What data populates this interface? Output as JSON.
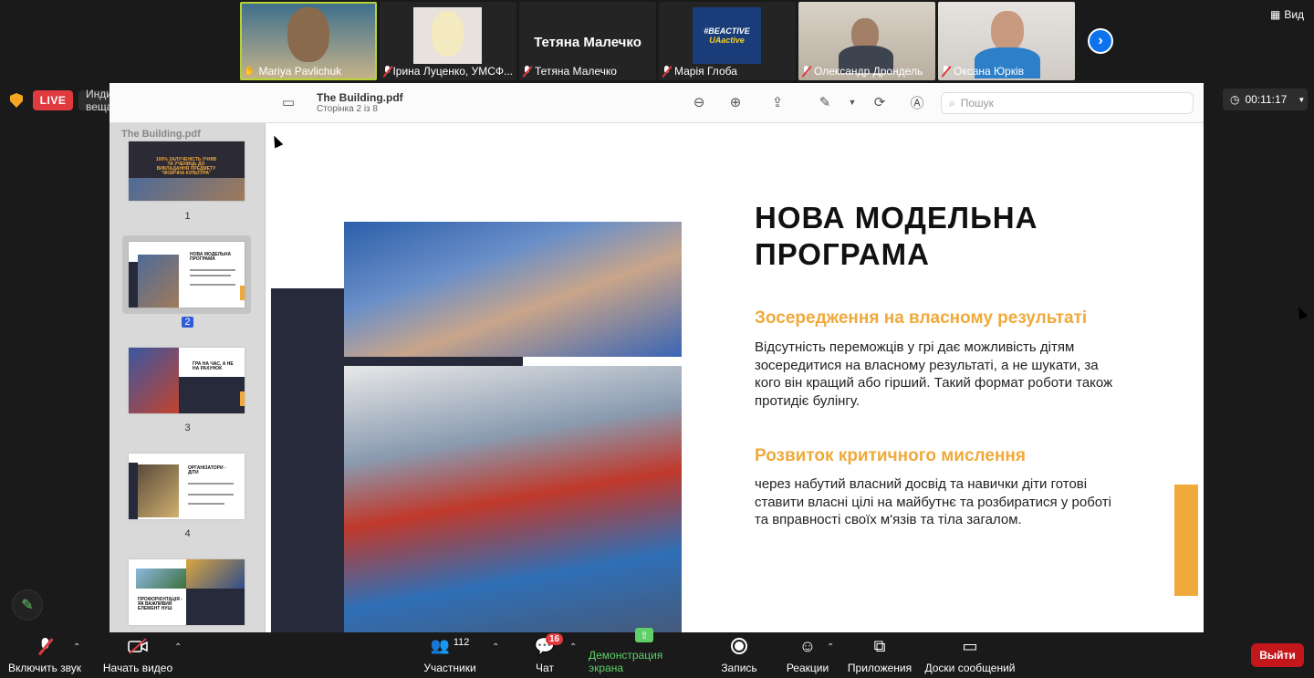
{
  "participants": [
    {
      "name": "Mariya Pavlichuk",
      "active": true
    },
    {
      "name": "Ірина Луценко, УМСФ..."
    },
    {
      "name": "Тетяна Малечко",
      "display": "Тетяна Малечко"
    },
    {
      "name": "Марія Глоба",
      "logo_line1": "#BEACTIVE",
      "logo_line2": "UAactive"
    },
    {
      "name": "Олександр Дрондель"
    },
    {
      "name": "Оксана Юрків"
    }
  ],
  "view_label": "Вид",
  "live_label": "LIVE",
  "stream_label": "Индивидуальная служба потокового вещания",
  "timer": "00:11:17",
  "pdf": {
    "title": "The Building.pdf",
    "page_info": "Сторінка 2 із 8",
    "search_placeholder": "Пошук",
    "sidebar_title": "The Building.pdf",
    "pages": [
      "1",
      "2",
      "3",
      "4"
    ],
    "thumb_texts": {
      "t1": "100% ЗАЛУЧЕНІСТЬ УЧНІВ ТА УЧЕНИЦЬ ДО ВИКЛАДАННЯ ПРЕДМЕТУ \"ФІЗИЧНА КУЛЬТУРА\"",
      "t2": "НОВА МОДЕЛЬНА ПРОГРАМА",
      "t3": "ГРА НА ЧАС, А НЕ НА РАХУНОК",
      "t4": "ОРГАНІЗАТОРИ - ДІТИ",
      "t5": "ПРОФОРІЄНТАЦІЯ - ЯК ВАЖЛИВИЙ ЕЛЕМЕНТ НУШ"
    }
  },
  "slide": {
    "title_line1": "НОВА МОДЕЛЬНА",
    "title_line2": "ПРОГРАМА",
    "h1": "Зосередження на власному результаті",
    "p1": "Відсутність переможців у грі дає можливість дітям зосередитися на власному результаті, а не шукати, за кого він кращий або гірший. Такий формат роботи також протидіє булінгу.",
    "h2": "Розвиток критичного мислення",
    "p2": "через набутий власний досвід та навички діти готові ставити власні цілі на майбутнє та розбиратися у роботі та вправності своїх м'язів та тіла загалом."
  },
  "toolbar": {
    "audio": "Включить звук",
    "video": "Начать видео",
    "participants": "Участники",
    "participants_count": "112",
    "chat": "Чат",
    "chat_badge": "16",
    "share": "Демонстрация экрана",
    "record": "Запись",
    "reactions": "Реакции",
    "apps": "Приложения",
    "boards": "Доски сообщений",
    "exit": "Выйти"
  },
  "colors": {
    "accent": "#f0a93b",
    "zoom_blue": "#0e72ed",
    "share_green": "#5fd068",
    "exit_red": "#c4171b",
    "live_red": "#e0393e"
  }
}
